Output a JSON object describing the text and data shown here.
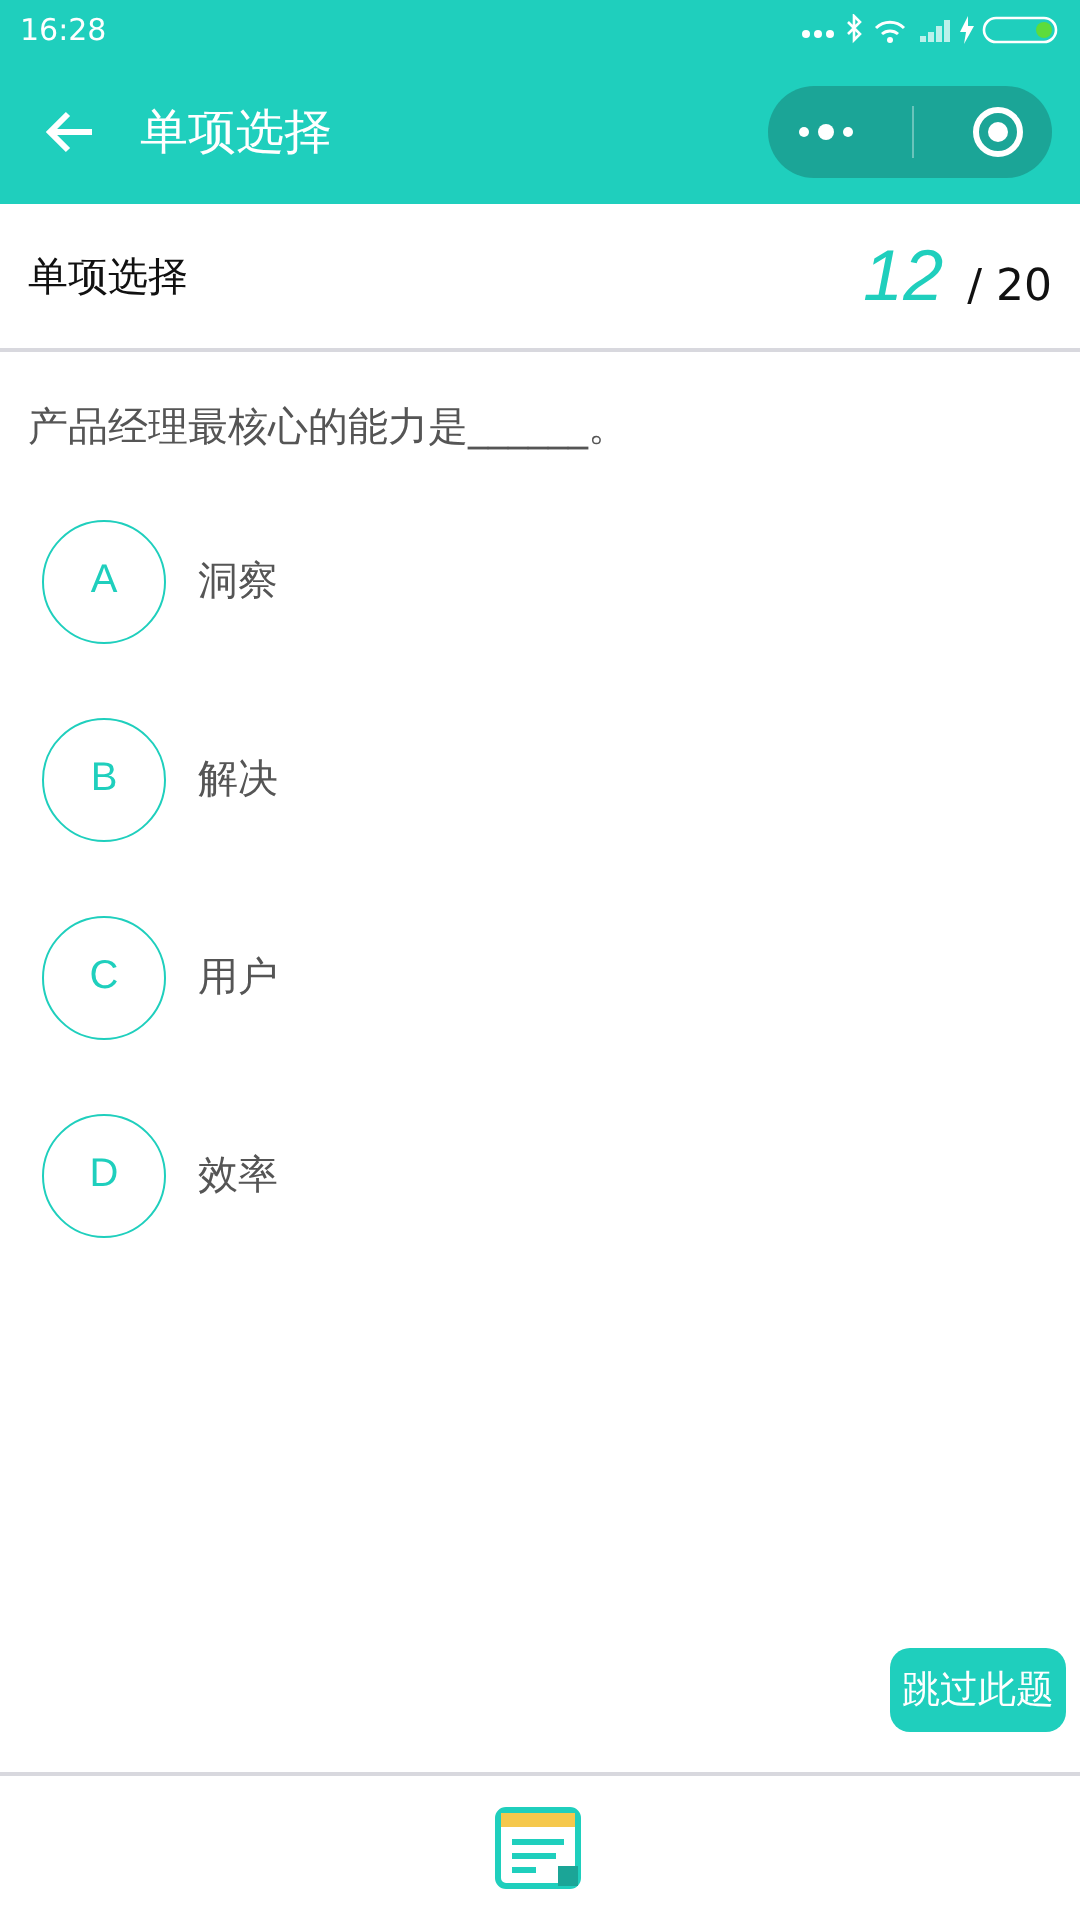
{
  "status_bar": {
    "time": "16:28"
  },
  "nav_bar": {
    "title": "单项选择"
  },
  "header": {
    "section": "单项选择",
    "current": "12",
    "total": "/ 20"
  },
  "question": {
    "text": "产品经理最核心的能力是______。"
  },
  "options": [
    {
      "letter": "A",
      "text": "洞察",
      "selected": false
    },
    {
      "letter": "B",
      "text": "解决",
      "selected": false
    },
    {
      "letter": "C",
      "text": "用户",
      "selected": false
    },
    {
      "letter": "D",
      "text": "效率",
      "selected": false
    }
  ],
  "skip_button": {
    "label": "跳过此题"
  }
}
